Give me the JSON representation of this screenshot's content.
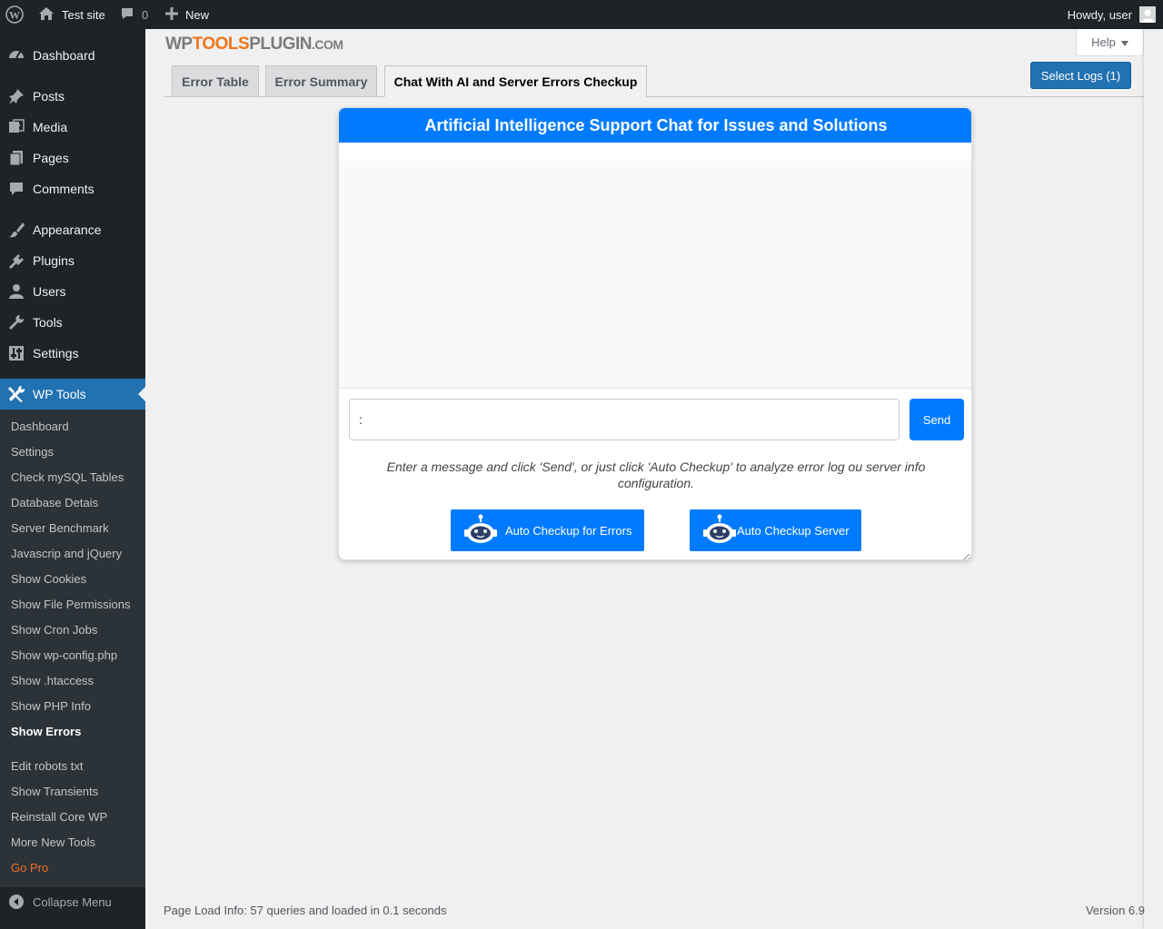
{
  "adminbar": {
    "site_name": "Test site",
    "comments_count": "0",
    "new_label": "New",
    "howdy": "Howdy, user"
  },
  "sidebar": {
    "items": [
      {
        "label": "Dashboard",
        "icon": "dashboard-icon"
      },
      {
        "label": "Posts",
        "icon": "pin-icon"
      },
      {
        "label": "Media",
        "icon": "media-icon"
      },
      {
        "label": "Pages",
        "icon": "pages-icon"
      },
      {
        "label": "Comments",
        "icon": "comment-icon"
      },
      {
        "label": "Appearance",
        "icon": "brush-icon"
      },
      {
        "label": "Plugins",
        "icon": "plug-icon"
      },
      {
        "label": "Users",
        "icon": "user-icon"
      },
      {
        "label": "Tools",
        "icon": "wrench-icon"
      },
      {
        "label": "Settings",
        "icon": "sliders-icon"
      },
      {
        "label": "WP Tools",
        "icon": "tools-icon"
      }
    ],
    "submenu": [
      "Dashboard",
      "Settings",
      "Check mySQL Tables",
      "Database Detais",
      "Server Benchmark",
      "Javascrip and jQuery",
      "Show Cookies",
      "Show File Permissions",
      "Show Cron Jobs",
      "Show wp-config.php",
      "Show .htaccess",
      "Show PHP Info",
      "Show Errors",
      "Edit robots txt",
      "Show Transients",
      "Reinstall Core WP",
      "More New Tools",
      "Go Pro"
    ],
    "collapse_label": "Collapse Menu"
  },
  "logo": {
    "part1": "WP",
    "part2": "TOOLS",
    "part3": "PLUGIN",
    "part4": ".COM"
  },
  "help_label": "Help",
  "tabs": [
    "Error Table",
    "Error Summary",
    "Chat With AI and Server Errors Checkup"
  ],
  "select_logs_label": "Select Logs (1)",
  "chat": {
    "title": "Artificial Intelligence Support Chat for Issues and Solutions",
    "input_value": ":",
    "send_label": "Send",
    "instructions": "Enter a message and click 'Send', or just click 'Auto Checkup' to analyze error log ou server info configuration.",
    "auto_errors_label": "Auto Checkup for Errors",
    "auto_server_label": "Auto Checkup Server"
  },
  "footer": {
    "page_load": "Page Load Info: 57 queries and loaded in 0.1 seconds",
    "version": "Version 6.9"
  },
  "colors": {
    "admin_dark": "#1d2327",
    "wp_blue": "#2271b1",
    "chat_blue": "#007bff",
    "gopro_orange": "#f56e28"
  }
}
